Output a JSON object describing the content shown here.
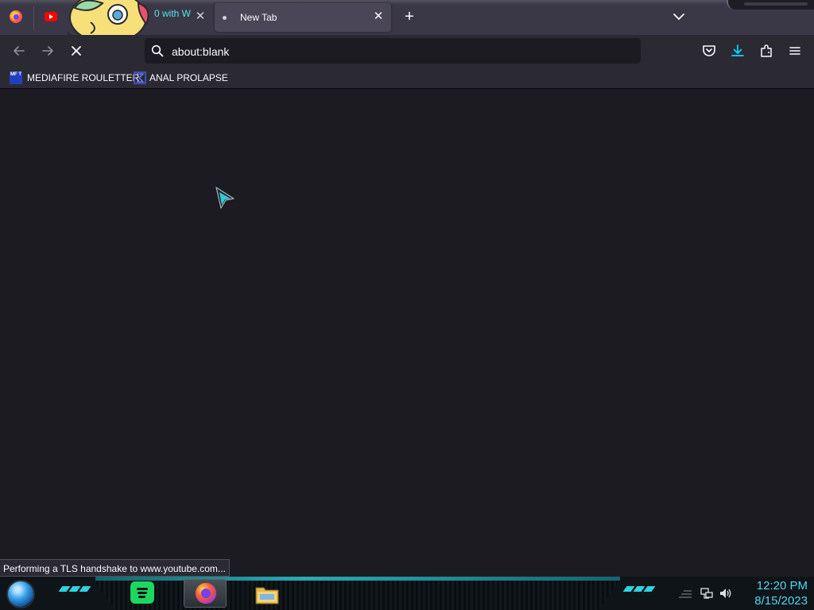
{
  "tabs": [
    {
      "title": "0 with W",
      "favicon": "youtube-icon",
      "active": false
    },
    {
      "title": "New Tab",
      "favicon": "loading-dot",
      "active": true
    }
  ],
  "navbar": {
    "url": "about:blank",
    "back_icon": "arrow-left-icon",
    "forward_icon": "arrow-right-icon",
    "stop_icon": "close-icon",
    "right_icons": [
      "pocket-icon",
      "download-icon",
      "extensions-icon",
      "menu-icon"
    ]
  },
  "bookmarks": [
    {
      "label": "MEDIAFIRE ROULETTER",
      "icon": "mediafire-icon",
      "icon_text": "MF T"
    },
    {
      "label": "ANAL PROLAPSE",
      "icon": "sigma-icon"
    }
  ],
  "status": {
    "text": "Performing a TLS handshake to www.youtube.com..."
  },
  "taskbar": {
    "apps": [
      "start-orb",
      "spotify-icon",
      "firefox-icon",
      "file-explorer-icon"
    ],
    "tray_icons": [
      "network-icon",
      "volume-icon"
    ],
    "clock_time": "12:20 PM",
    "clock_date": "8/15/2023"
  },
  "colors": {
    "background": "#1c1b22",
    "toolbar": "#2b2a33",
    "tabstrip": "#3a3746",
    "accent": "#51e8ea",
    "clock": "#4fd6f0"
  }
}
